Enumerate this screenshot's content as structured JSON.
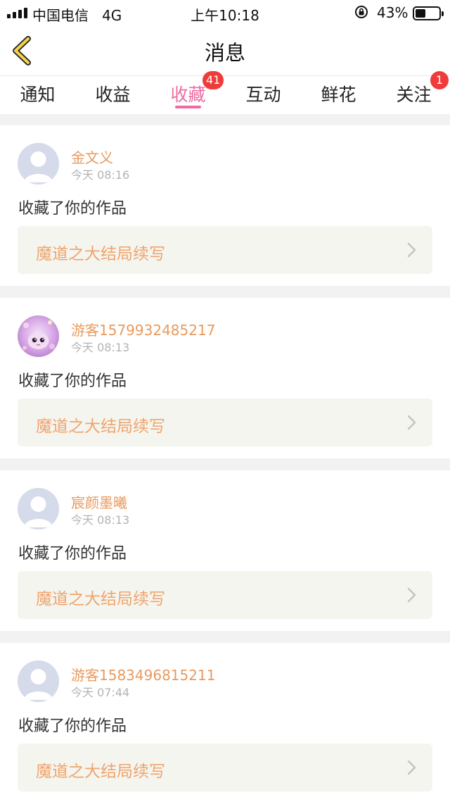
{
  "status_bar": {
    "carrier": "中国电信",
    "network": "4G",
    "time": "上午10:18",
    "battery": "43%"
  },
  "nav": {
    "title": "消息"
  },
  "tabs": [
    {
      "label": "通知",
      "badge": ""
    },
    {
      "label": "收益",
      "badge": ""
    },
    {
      "label": "收藏",
      "badge": "41",
      "active": true
    },
    {
      "label": "互动",
      "badge": ""
    },
    {
      "label": "鲜花",
      "badge": ""
    },
    {
      "label": "关注",
      "badge": "1"
    }
  ],
  "notifications": [
    {
      "username": "金文义",
      "time": "今天 08:16",
      "action": "收藏了你的作品",
      "work_title": "魔道之大结局续写",
      "avatar": "default-avatar"
    },
    {
      "username": "游客1579932485217",
      "time": "今天 08:13",
      "action": "收藏了你的作品",
      "work_title": "魔道之大结局续写",
      "avatar": "custom-avatar"
    },
    {
      "username": "宸颜墨曦",
      "time": "今天 08:13",
      "action": "收藏了你的作品",
      "work_title": "魔道之大结局续写",
      "avatar": "default-avatar"
    },
    {
      "username": "游客1583496815211",
      "time": "今天 07:44",
      "action": "收藏了你的作品",
      "work_title": "魔道之大结局续写",
      "avatar": "default-avatar"
    }
  ],
  "colors": {
    "accent_pink": "#f06aa3",
    "badge_red": "#f03b3b",
    "username_orange": "#e99a5e",
    "work_title_orange": "#f0a46d"
  }
}
